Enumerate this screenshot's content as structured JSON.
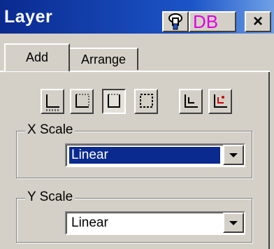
{
  "window": {
    "title": "Layer"
  },
  "titlebar_buttons": [
    {
      "name": "pin-icon"
    },
    {
      "name": "db-icon",
      "label": "DB"
    },
    {
      "name": "close-icon",
      "label": "×"
    }
  ],
  "tabs": [
    {
      "label": "Add",
      "active": true
    },
    {
      "label": "Arrange",
      "active": false
    }
  ],
  "axis_buttons": [
    {
      "name": "axis-bottom-left-button",
      "icon": "axis-bottom-left-icon",
      "pressed": false
    },
    {
      "name": "axis-box-dotted-button",
      "icon": "axis-box-dotted-icon",
      "pressed": false
    },
    {
      "name": "axis-u-shape-button",
      "icon": "axis-u-shape-icon",
      "pressed": true
    },
    {
      "name": "axis-box-solid-button",
      "icon": "axis-box-solid-icon",
      "pressed": false
    },
    {
      "name": "add-inset-button",
      "icon": "inset-plot-icon",
      "pressed": false
    },
    {
      "name": "add-inset-red-button",
      "icon": "inset-plot-red-icon",
      "pressed": false
    }
  ],
  "x_scale": {
    "label": "X Scale",
    "value": "Linear"
  },
  "y_scale": {
    "label": "Y Scale",
    "value": "Linear"
  },
  "colors": {
    "title_bg": "#0a2a8f",
    "face": "#d4d0c8",
    "selection": "#0a2a8f",
    "db_magenta": "#e000e0",
    "inset_red": "#d00000"
  }
}
